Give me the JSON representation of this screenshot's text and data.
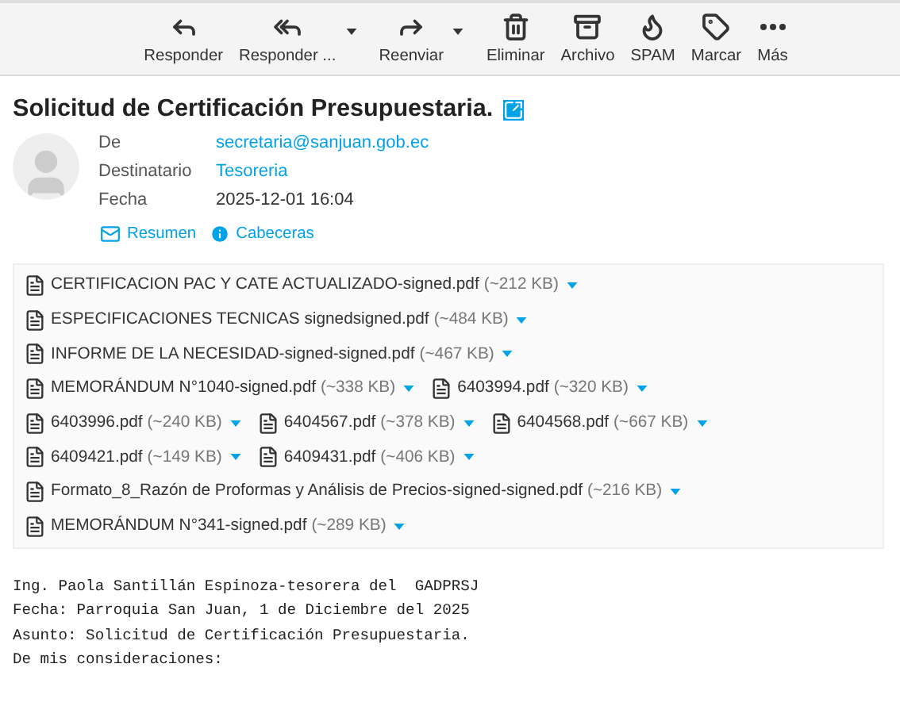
{
  "toolbar": [
    {
      "label": "Responder",
      "kind": "reply",
      "dropdown": false
    },
    {
      "label": "Responder ...",
      "kind": "replyall",
      "dropdown": true
    },
    {
      "label": "Reenviar",
      "kind": "forward",
      "dropdown": true
    },
    {
      "label": "Eliminar",
      "kind": "delete",
      "dropdown": false
    },
    {
      "label": "Archivo",
      "kind": "archive",
      "dropdown": false
    },
    {
      "label": "SPAM",
      "kind": "spam",
      "dropdown": false
    },
    {
      "label": "Marcar",
      "kind": "mark",
      "dropdown": false
    },
    {
      "label": "Más",
      "kind": "more",
      "dropdown": false
    }
  ],
  "subject": "Solicitud de Certificación Presupuestaria.",
  "headers": [
    {
      "label": "De",
      "value": "secretaria@sanjuan.gob.ec",
      "link": true
    },
    {
      "label": "Destinatario",
      "value": "Tesoreria",
      "link": true
    },
    {
      "label": "Fecha",
      "value": "2025-12-01 16:04",
      "link": false
    }
  ],
  "header_links": [
    {
      "label": "Resumen",
      "kind": "summary"
    },
    {
      "label": "Cabeceras",
      "kind": "headers"
    }
  ],
  "attachment_rows": [
    [
      {
        "name": "CERTIFICACION PAC Y CATE ACTUALIZADO-signed.pdf",
        "size": "(~212 KB)"
      }
    ],
    [
      {
        "name": "ESPECIFICACIONES TECNICAS signedsigned.pdf",
        "size": "(~484 KB)"
      }
    ],
    [
      {
        "name": "INFORME DE LA NECESIDAD-signed-signed.pdf",
        "size": "(~467 KB)"
      }
    ],
    [
      {
        "name": "MEMORÁNDUM N°1040-signed.pdf",
        "size": "(~338 KB)"
      },
      {
        "name": "6403994.pdf",
        "size": "(~320 KB)"
      }
    ],
    [
      {
        "name": "6403996.pdf",
        "size": "(~240 KB)"
      },
      {
        "name": "6404567.pdf",
        "size": "(~378 KB)"
      },
      {
        "name": "6404568.pdf",
        "size": "(~667 KB)"
      }
    ],
    [
      {
        "name": "6409421.pdf",
        "size": "(~149 KB)"
      },
      {
        "name": "6409431.pdf",
        "size": "(~406 KB)"
      }
    ],
    [
      {
        "name": "Formato_8_Razón de Proformas y Análisis de Precios-signed-signed.pdf",
        "size": "(~216 KB)"
      }
    ],
    [
      {
        "name": "MEMORÁNDUM N°341-signed.pdf",
        "size": "(~289 KB)"
      }
    ]
  ],
  "body_lines": [
    "Ing. Paola Santillán Espinoza-tesorera del  GADPRSJ",
    "Fecha: Parroquia San Juan, 1 de Diciembre del 2025",
    "Asunto: Solicitud de Certificación Presupuestaria.",
    "De mis consideraciones:"
  ]
}
